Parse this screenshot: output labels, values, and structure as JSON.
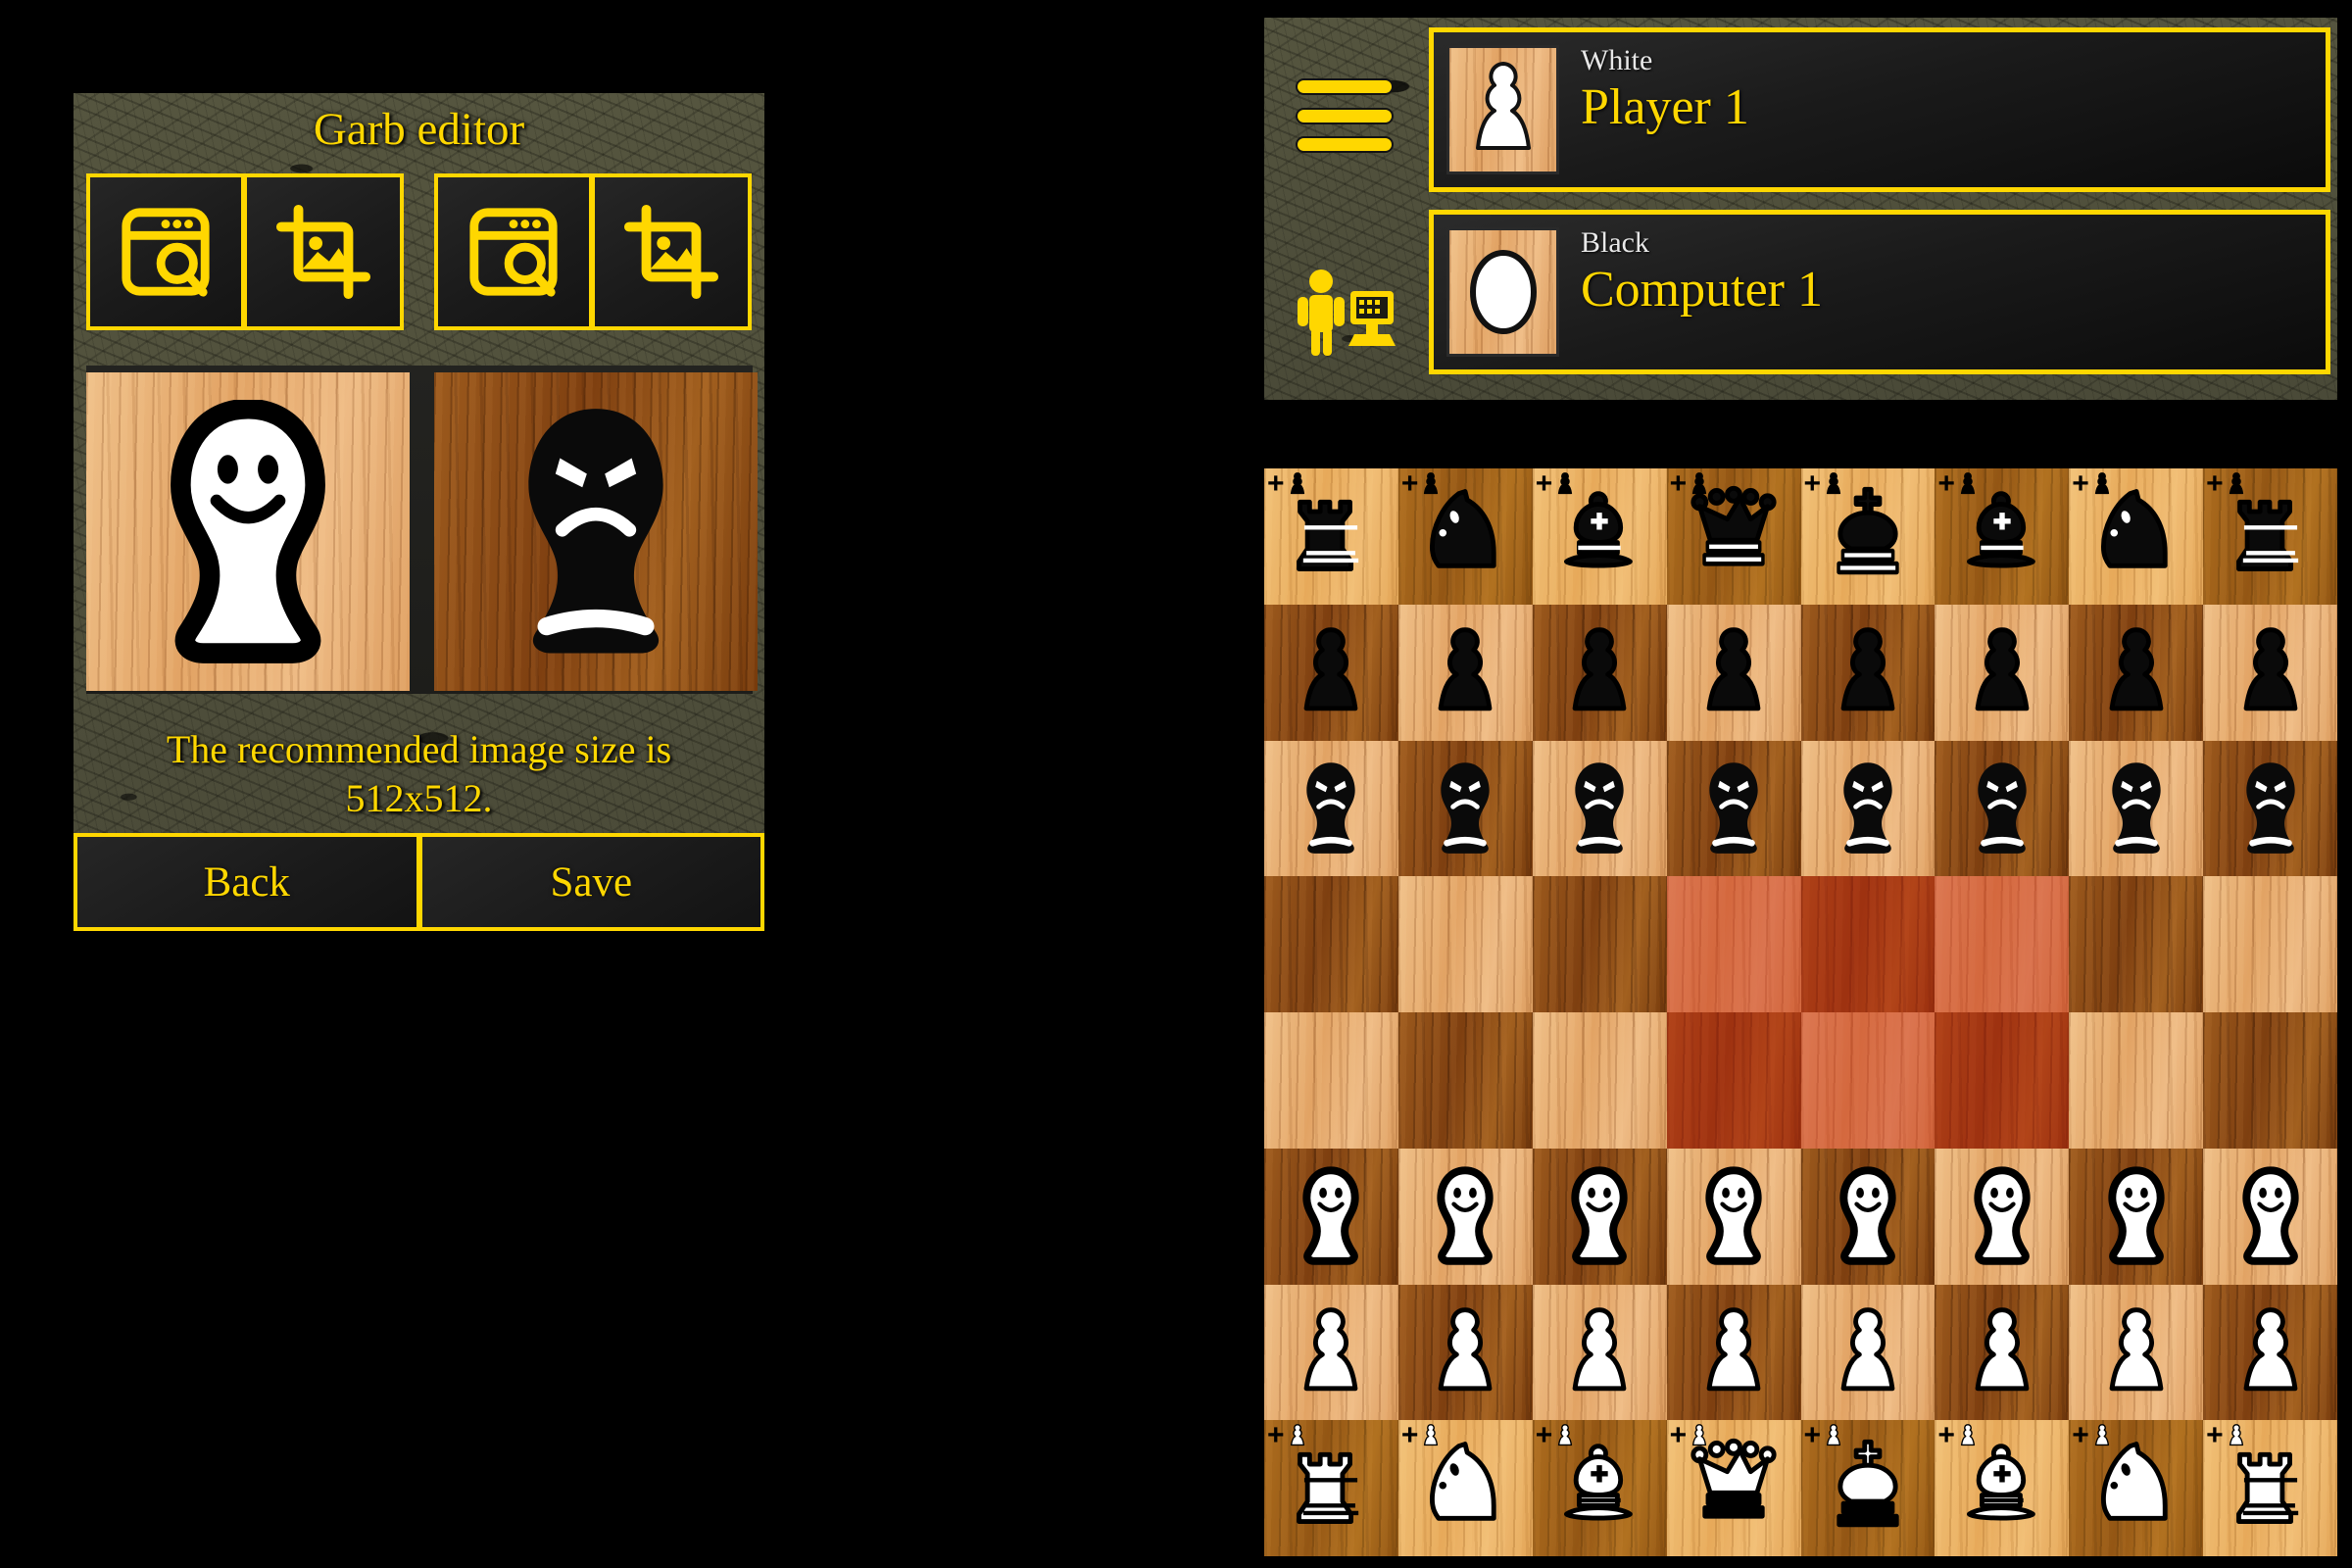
{
  "editor": {
    "title": "Garb editor",
    "hint": "The recommended image size is 512x512.",
    "icon_buttons": [
      {
        "name": "browse-file-white",
        "icon": "file-browser-search-icon",
        "label": ""
      },
      {
        "name": "crop-image-white",
        "icon": "crop-image-icon",
        "label": ""
      },
      {
        "name": "browse-file-black",
        "icon": "file-browser-search-icon",
        "label": ""
      },
      {
        "name": "crop-image-black",
        "icon": "crop-image-icon",
        "label": ""
      }
    ],
    "previews": [
      {
        "name": "white-garb-preview",
        "side": "white",
        "wood": "light",
        "face": "smiling-ghost"
      },
      {
        "name": "black-garb-preview",
        "side": "black",
        "wood": "dark",
        "face": "angry-ghost"
      }
    ],
    "back_label": "Back",
    "save_label": "Save"
  },
  "game": {
    "menu_icon": "hamburger-menu-icon",
    "mode_icon": "human-vs-computer-icon",
    "players": [
      {
        "side_label": "White",
        "name": "Player 1",
        "avatar": "white-pawn-icon"
      },
      {
        "side_label": "Black",
        "name": "Computer 1",
        "avatar": "black-ghost-icon"
      }
    ],
    "board": {
      "highlight_color": "#c42212",
      "light_square": "#e0a768",
      "dark_square": "#8a4a15",
      "highlighted_squares": [
        "d5",
        "e5",
        "f5",
        "d4",
        "e4",
        "f4"
      ],
      "rows": [
        [
          {
            "piece": "rook",
            "color": "black",
            "promo": true
          },
          {
            "piece": "knight",
            "color": "black",
            "promo": true
          },
          {
            "piece": "bishop",
            "color": "black",
            "promo": true
          },
          {
            "piece": "queen",
            "color": "black",
            "promo": true
          },
          {
            "piece": "king",
            "color": "black",
            "promo": true
          },
          {
            "piece": "bishop",
            "color": "black",
            "promo": true
          },
          {
            "piece": "knight",
            "color": "black",
            "promo": true
          },
          {
            "piece": "rook",
            "color": "black",
            "promo": true
          }
        ],
        [
          {
            "piece": "pawn",
            "color": "black"
          },
          {
            "piece": "pawn",
            "color": "black"
          },
          {
            "piece": "pawn",
            "color": "black"
          },
          {
            "piece": "pawn",
            "color": "black"
          },
          {
            "piece": "pawn",
            "color": "black"
          },
          {
            "piece": "pawn",
            "color": "black"
          },
          {
            "piece": "pawn",
            "color": "black"
          },
          {
            "piece": "pawn",
            "color": "black"
          }
        ],
        [
          {
            "piece": "garb",
            "color": "black"
          },
          {
            "piece": "garb",
            "color": "black"
          },
          {
            "piece": "garb",
            "color": "black"
          },
          {
            "piece": "garb",
            "color": "black"
          },
          {
            "piece": "garb",
            "color": "black"
          },
          {
            "piece": "garb",
            "color": "black"
          },
          {
            "piece": "garb",
            "color": "black"
          },
          {
            "piece": "garb",
            "color": "black"
          }
        ],
        [
          null,
          null,
          null,
          null,
          null,
          null,
          null,
          null
        ],
        [
          null,
          null,
          null,
          null,
          null,
          null,
          null,
          null
        ],
        [
          {
            "piece": "garb",
            "color": "white"
          },
          {
            "piece": "garb",
            "color": "white"
          },
          {
            "piece": "garb",
            "color": "white"
          },
          {
            "piece": "garb",
            "color": "white"
          },
          {
            "piece": "garb",
            "color": "white"
          },
          {
            "piece": "garb",
            "color": "white"
          },
          {
            "piece": "garb",
            "color": "white"
          },
          {
            "piece": "garb",
            "color": "white"
          }
        ],
        [
          {
            "piece": "pawn",
            "color": "white"
          },
          {
            "piece": "pawn",
            "color": "white"
          },
          {
            "piece": "pawn",
            "color": "white"
          },
          {
            "piece": "pawn",
            "color": "white"
          },
          {
            "piece": "pawn",
            "color": "white"
          },
          {
            "piece": "pawn",
            "color": "white"
          },
          {
            "piece": "pawn",
            "color": "white"
          },
          {
            "piece": "pawn",
            "color": "white"
          }
        ],
        [
          {
            "piece": "rook",
            "color": "white",
            "promo": true
          },
          {
            "piece": "knight",
            "color": "white",
            "promo": true
          },
          {
            "piece": "bishop",
            "color": "white",
            "promo": true
          },
          {
            "piece": "queen",
            "color": "white",
            "promo": true
          },
          {
            "piece": "king",
            "color": "white",
            "promo": true
          },
          {
            "piece": "bishop",
            "color": "white",
            "promo": true
          },
          {
            "piece": "knight",
            "color": "white",
            "promo": true
          },
          {
            "piece": "rook",
            "color": "white",
            "promo": true
          }
        ]
      ]
    }
  }
}
